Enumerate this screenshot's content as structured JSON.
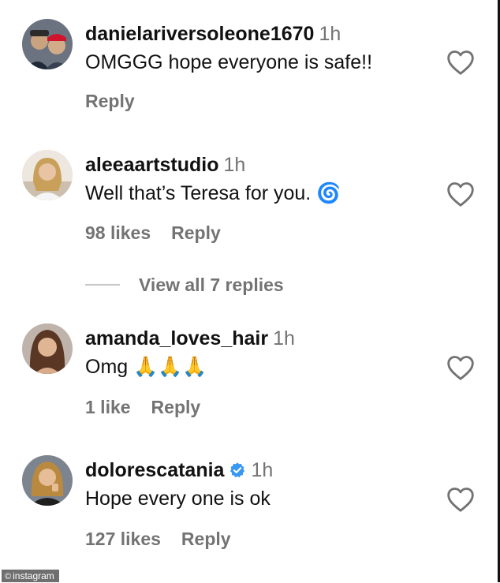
{
  "comments": [
    {
      "username": "danielariversoleone1670",
      "time": "1h",
      "text": "OMGGG hope everyone is safe!!",
      "likes": "",
      "reply_label": "Reply"
    },
    {
      "username": "aleeaartstudio",
      "time": "1h",
      "text": "Well that’s Teresa for you. 🌀",
      "likes": "98 likes",
      "reply_label": "Reply"
    },
    {
      "username": "amanda_loves_hair",
      "time": "1h",
      "text": "Omg 🙏🙏🙏",
      "likes": "1 like",
      "reply_label": "Reply"
    },
    {
      "username": "dolorescatania",
      "time": "1h",
      "text": "Hope every one is ok",
      "likes": "127 likes",
      "reply_label": "Reply",
      "verified": true
    }
  ],
  "view_replies": "View all 7 replies",
  "watermark": {
    "symbol": "©",
    "text": "instagram"
  },
  "colors": {
    "username": "#111111",
    "secondary": "#737373",
    "verified_badge": "#3897f0",
    "divider": "#c7c7c7"
  },
  "icons": {
    "like": "heart-outline-icon",
    "verified": "verified-badge-icon"
  }
}
